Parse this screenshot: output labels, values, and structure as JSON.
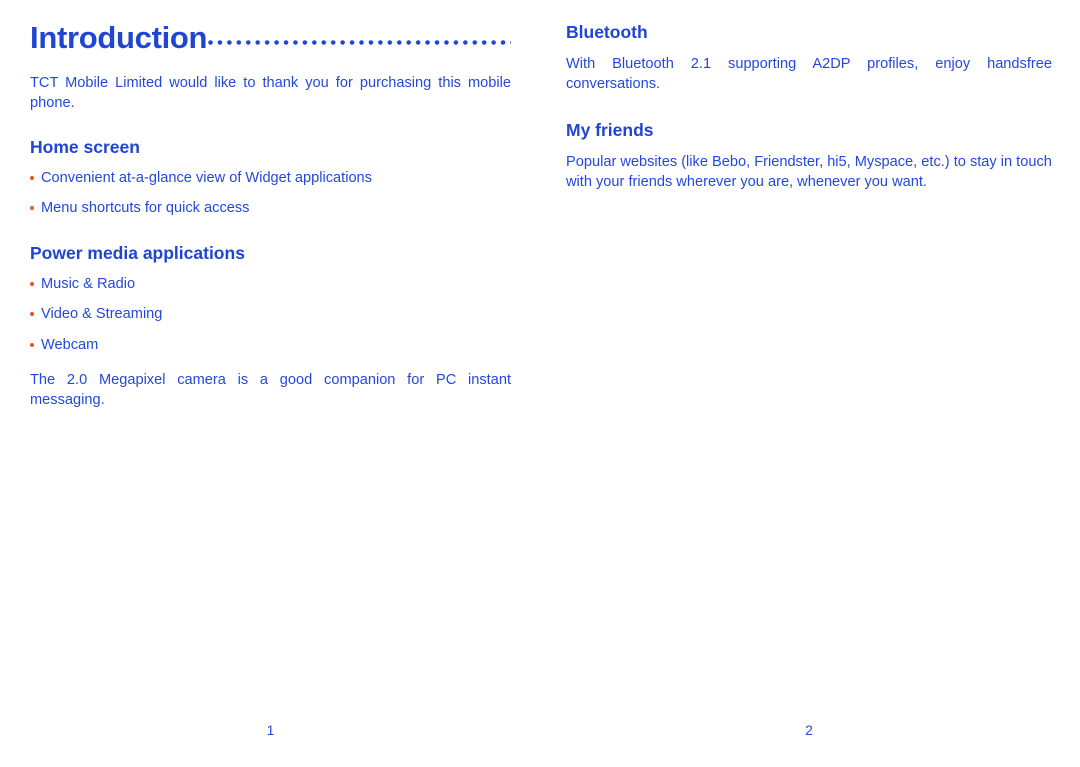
{
  "document": {
    "colors": {
      "text_blue": "#2448dd",
      "heading_blue": "#1f45d2",
      "bullet_orange": "#e8551f",
      "background": "#ffffff"
    }
  },
  "left_page": {
    "chapter_title": "Introduction",
    "leader_style": "dotted",
    "intro_paragraph": "TCT Mobile Limited would like to thank you for purchasing this mobile phone.",
    "sections": [
      {
        "heading": "Home screen",
        "bullets": [
          "Convenient at-a-glance view of Widget applications",
          "Menu shortcuts for quick access"
        ]
      },
      {
        "heading": "Power media applications",
        "bullets": [
          "Music & Radio",
          "Video & Streaming",
          "Webcam"
        ],
        "paragraph": "The 2.0 Megapixel camera is a good companion for PC instant messaging."
      }
    ],
    "page_number": "1"
  },
  "right_page": {
    "sections": [
      {
        "heading": "Bluetooth",
        "paragraph": "With Bluetooth 2.1 supporting A2DP profiles, enjoy handsfree conversations."
      },
      {
        "heading": "My friends",
        "paragraph": "Popular websites (like Bebo, Friendster, hi5, Myspace, etc.) to stay in touch with your friends wherever you are, whenever you want."
      }
    ],
    "page_number": "2"
  }
}
